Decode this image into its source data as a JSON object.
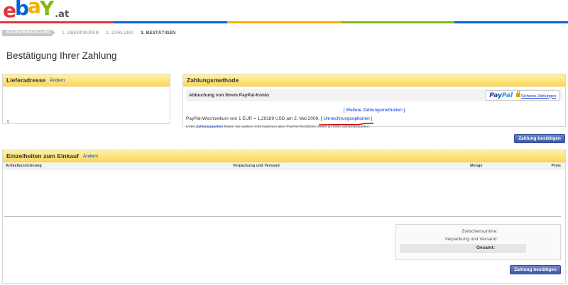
{
  "header": {
    "logo_tld": ".at"
  },
  "steps": [
    {
      "label": "KAUFABWICKLUNG"
    },
    {
      "label": "1. ÜBERPRÜFEN"
    },
    {
      "label": "2. ZAHLUNG"
    },
    {
      "label": "3. BESTÄTIGEN"
    }
  ],
  "page_title": "Bestätigung Ihrer Zahlung",
  "delivery": {
    "title": "Lieferadresse",
    "change_link": "Ändern"
  },
  "payment": {
    "title": "Zahlungsmethode",
    "subtitle": "Abbuchung von Ihrem PayPal-Konto",
    "paypal_pay": "Pay",
    "paypal_pal": "Pal",
    "secure_link": "Sicheres Zahlungen",
    "more_methods": "[ Weitere Zahlungsmethoden ]",
    "rate_text": "PayPal-Wechselkurs von 1 EUR = 1,29189 USD am 2. Mai 2009.",
    "conversion_options": "[ Umrechnungsoptionen ]",
    "info_prefix": "Unter",
    "info_link": "Zahlungsquellen",
    "info_suffix": "finden Sie weitere Informationen über PayPal-Richtlinien sowie zu Ihren Zahlungsquellen.",
    "annotation_color": "#cc0000"
  },
  "buttons": {
    "confirm_top": "Zahlung bestätigen",
    "confirm_bottom": "Zahlung bestätigen"
  },
  "purchase": {
    "title": "Einzelheiten zum Einkauf",
    "change_link": "Ändern",
    "columns": {
      "item": "Artikelbezeichnung",
      "shipping": "Verpackung und Versand",
      "quantity": "Menge",
      "price": "Preis"
    }
  },
  "totals": {
    "subtotal_label": "Zwischensumme:",
    "shipping_label": "Verpackung und Versand:",
    "total_label": "Gesamt:"
  },
  "colors": {
    "panel_header": "#fbd75c",
    "button": "#3e5aa7",
    "link": "#0033cc"
  }
}
